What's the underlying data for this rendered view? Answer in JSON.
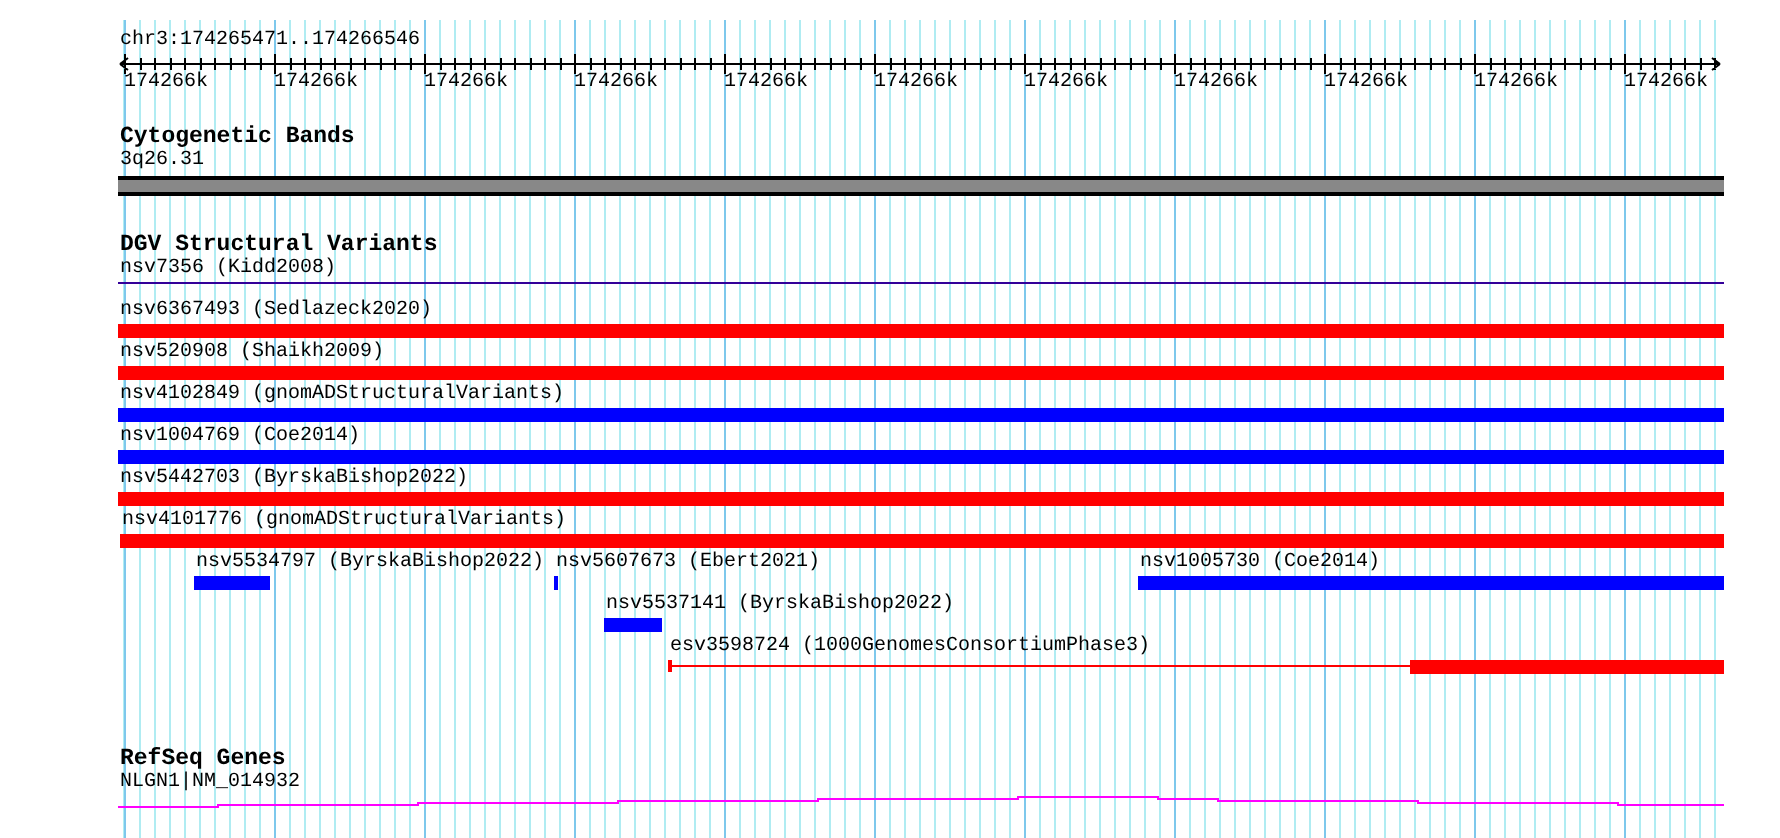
{
  "location": "chr3:174265471..174266546",
  "ruler": {
    "labels": [
      "174266k",
      "174266k",
      "174266k",
      "174266k",
      "174266k",
      "174266k",
      "174266k",
      "174266k",
      "174266k",
      "174266k",
      "174266k"
    ]
  },
  "tracks": [
    {
      "kind": "bands",
      "title": "Cytogenetic Bands",
      "features": [
        {
          "label": "3q26.31"
        }
      ]
    },
    {
      "kind": "variants",
      "title": "DGV Structural Variants",
      "rows": [
        [
          {
            "label": "nsv7356 (Kidd2008)",
            "kind": "line",
            "color": "#330099"
          }
        ],
        [
          {
            "label": "nsv6367493 (Sedlazeck2020)",
            "kind": "bar",
            "color": "#ff0000"
          }
        ],
        [
          {
            "label": "nsv520908 (Shaikh2009)",
            "kind": "bar",
            "color": "#ff0000"
          }
        ],
        [
          {
            "label": "nsv4102849 (gnomADStructuralVariants)",
            "kind": "bar",
            "color": "#0000ff"
          }
        ],
        [
          {
            "label": "nsv1004769 (Coe2014)",
            "kind": "bar",
            "color": "#0000ff"
          }
        ],
        [
          {
            "label": "nsv5442703 (ByrskaBishop2022)",
            "kind": "bar",
            "color": "#ff0000"
          }
        ],
        [
          {
            "label": "nsv4101776 (gnomADStructuralVariants)",
            "kind": "bar",
            "color": "#ff0000"
          }
        ],
        [
          {
            "label": "nsv5534797 (ByrskaBishop2022)",
            "kind": "bar",
            "color": "#0000ff"
          },
          {
            "label": "nsv5607673 (Ebert2021)",
            "kind": "bar",
            "color": "#0000ff"
          },
          {
            "label": "nsv1005730 (Coe2014)",
            "kind": "bar",
            "color": "#0000ff"
          }
        ],
        [
          {
            "label": "nsv5537141 (ByrskaBishop2022)",
            "kind": "bar",
            "color": "#0000ff"
          }
        ],
        [
          {
            "label": "esv3598724 (1000GenomesConsortiumPhase3)",
            "kind": "partial",
            "color": "#ff0000"
          }
        ]
      ]
    },
    {
      "kind": "genes",
      "title": "RefSeq Genes",
      "features": [
        {
          "label": "NLGN1|NM_014932"
        }
      ]
    }
  ]
}
